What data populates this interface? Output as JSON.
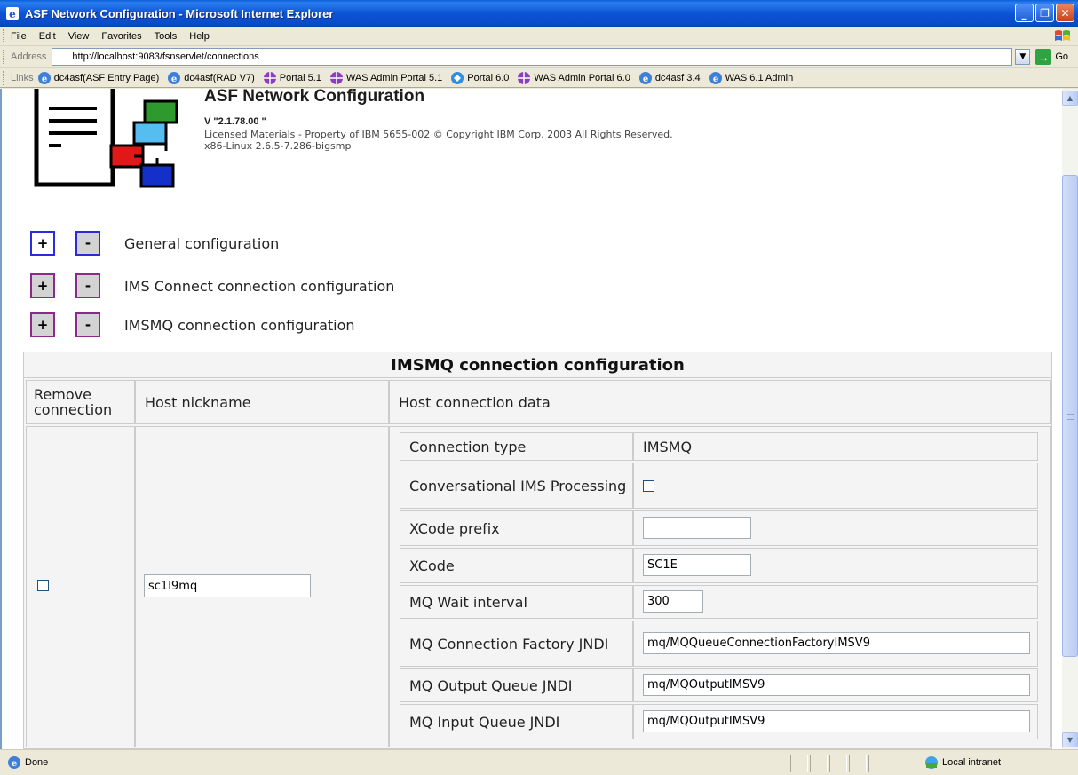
{
  "window": {
    "title": "ASF Network Configuration - Microsoft Internet Explorer",
    "buttons": [
      "minimize",
      "restore",
      "close"
    ]
  },
  "menu": {
    "items": [
      "File",
      "Edit",
      "View",
      "Favorites",
      "Tools",
      "Help"
    ]
  },
  "address": {
    "label": "Address",
    "url": "http://localhost:9083/fsnservlet/connections",
    "go_label": "Go"
  },
  "links": {
    "label": "Links",
    "items": [
      {
        "label": "dc4asf(ASF Entry Page)",
        "icon": "ie-page-icon"
      },
      {
        "label": "dc4asf(RAD V7)",
        "icon": "ie-page-icon"
      },
      {
        "label": "Portal 5.1",
        "icon": "portal-globe-icon"
      },
      {
        "label": "WAS Admin Portal 5.1",
        "icon": "portal-globe-icon"
      },
      {
        "label": "Portal 6.0",
        "icon": "portal-blue-icon"
      },
      {
        "label": "WAS Admin Portal 6.0",
        "icon": "portal-globe-icon"
      },
      {
        "label": "dc4asf 3.4",
        "icon": "ie-page-icon"
      },
      {
        "label": "WAS 6.1 Admin",
        "icon": "ie-page-icon"
      }
    ]
  },
  "header": {
    "title": "ASF Network Configuration",
    "version": "V \"2.1.78.00 \"",
    "license": "Licensed Materials - Property of IBM 5655-002 © Copyright IBM Corp. 2003 All Rights Reserved.",
    "platform": "x86-Linux 2.6.5-7.286-bigsmp"
  },
  "sections": [
    {
      "label": "General configuration",
      "plus": "+",
      "minus": "-"
    },
    {
      "label": "IMS Connect connection configuration",
      "plus": "+",
      "minus": "-"
    },
    {
      "label": "IMSMQ connection configuration",
      "plus": "+",
      "minus": "-"
    }
  ],
  "imsmq": {
    "title": "IMSMQ connection configuration",
    "col_remove": "Remove connection",
    "col_nickname": "Host nickname",
    "col_data": "Host connection data",
    "nickname_value": "sc1I9mq",
    "rows": {
      "conn_type_label": "Connection type",
      "conn_type_value": "IMSMQ",
      "conversational_label": "Conversational IMS Processing",
      "xcode_prefix_label": "XCode prefix",
      "xcode_prefix_value": "",
      "xcode_label": "XCode",
      "xcode_value": "SC1E",
      "wait_label": "MQ Wait interval",
      "wait_value": "300",
      "factory_label": "MQ Connection Factory JNDI",
      "factory_value": "mq/MQQueueConnectionFactoryIMSV9",
      "output_label": "MQ Output Queue JNDI",
      "output_value": "mq/MQOutputIMSV9",
      "input_label": "MQ Input Queue JNDI",
      "input_value": "mq/MQOutputIMSV9"
    }
  },
  "status": {
    "text": "Done",
    "zone": "Local intranet"
  }
}
